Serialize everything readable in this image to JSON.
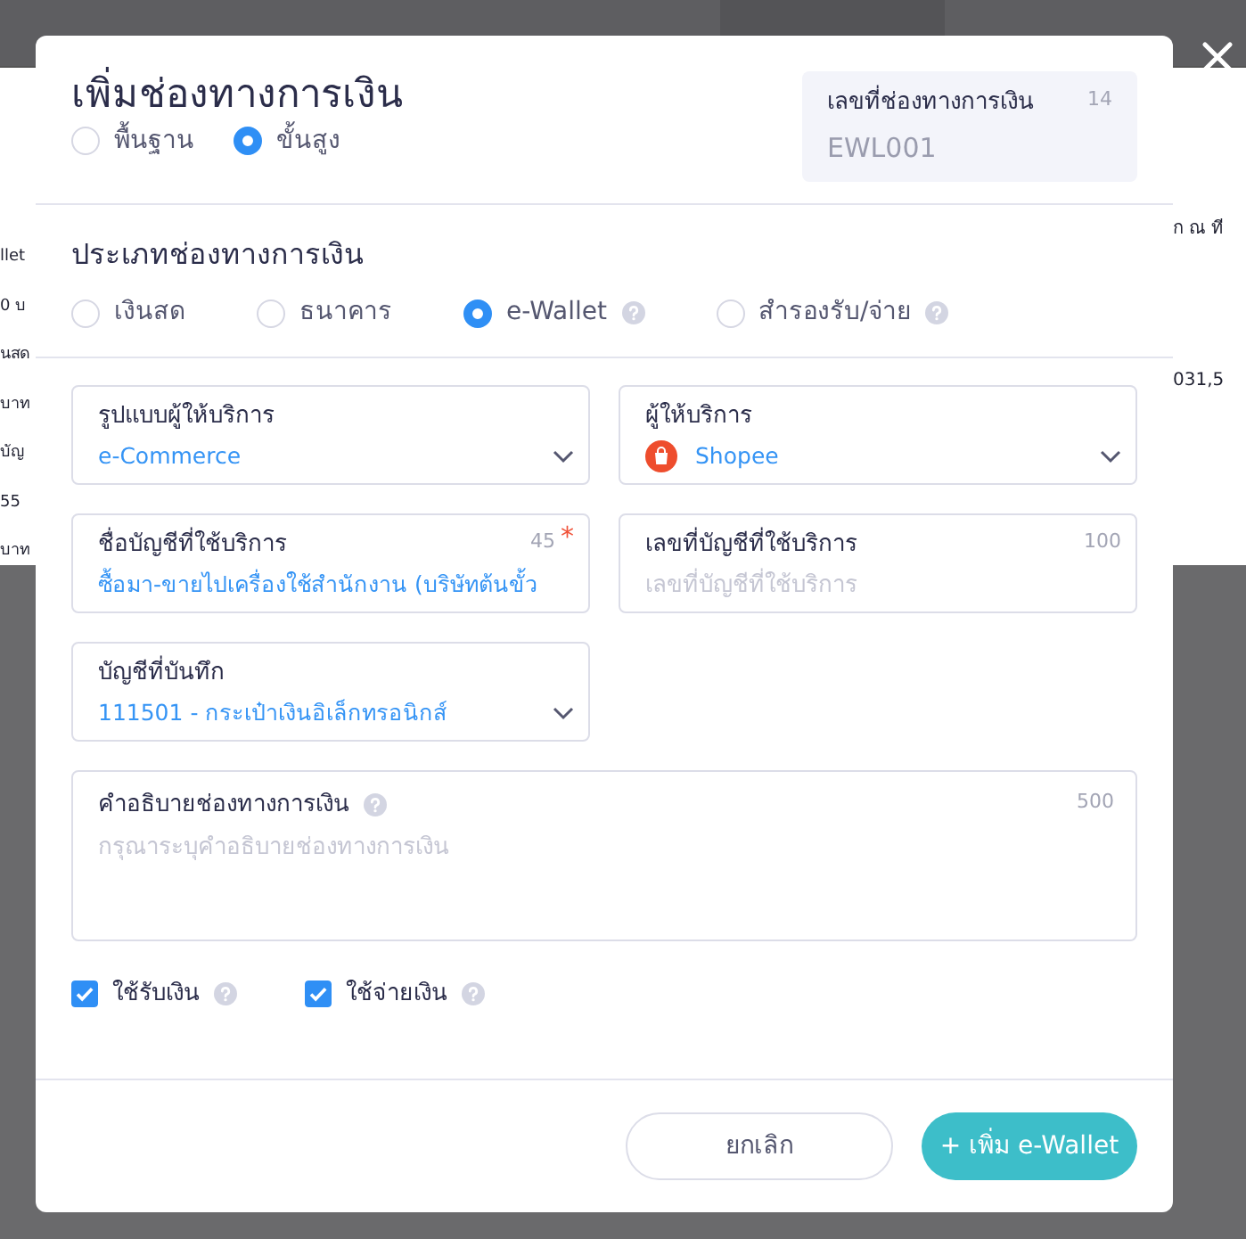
{
  "background": {
    "left_fragments": [
      "llet",
      "0 บ",
      "นสด",
      "บาท",
      "บัญ",
      "55",
      "บาท"
    ],
    "right_fragments": [
      "ก ณ ที",
      "031,5"
    ]
  },
  "header": {
    "title": "เพิ่มช่องทางการเงิน",
    "modes": [
      {
        "label": "พื้นฐาน",
        "selected": false
      },
      {
        "label": "ขั้นสูง",
        "selected": true
      }
    ],
    "code_box": {
      "label": "เลขที่ช่องทางการเงิน",
      "counter": "14",
      "value": "EWL001"
    }
  },
  "type_section": {
    "title": "ประเภทช่องทางการเงิน",
    "options": [
      {
        "label": "เงินสด",
        "selected": false,
        "help": false
      },
      {
        "label": "ธนาคาร",
        "selected": false,
        "help": false
      },
      {
        "label": "e-Wallet",
        "selected": true,
        "help": true
      },
      {
        "label": "สำรองรับ/จ่าย",
        "selected": false,
        "help": true
      }
    ]
  },
  "fields": [
    {
      "kind": "select",
      "label": "รูปแบบผู้ให้บริการ",
      "value": "e-Commerce"
    },
    {
      "kind": "logo-select",
      "label": "ผู้ให้บริการ",
      "value": "Shopee"
    },
    {
      "kind": "input",
      "label": "ชื่อบัญชีที่ใช้บริการ",
      "counter": "45",
      "required_mark": "*",
      "value": "ซื้อมา-ขายไปเครื่องใช้สำนักงาน (บริษัทต้นขั้ว"
    },
    {
      "kind": "input",
      "label": "เลขที่บัญชีที่ใช้บริการ",
      "counter": "100",
      "placeholder": "เลขที่บัญชีที่ใช้บริการ"
    },
    {
      "kind": "select",
      "label": "บัญชีที่บันทึก",
      "value": "111501 - กระเป๋าเงินอิเล็กทรอนิกส์"
    }
  ],
  "description": {
    "label": "คำอธิบายช่องทางการเงิน",
    "help": true,
    "counter": "500",
    "placeholder": "กรุณาระบุคำอธิบายช่องทางการเงิน"
  },
  "checkboxes": [
    {
      "label": "ใช้รับเงิน",
      "checked": true,
      "help": true
    },
    {
      "label": "ใช้จ่ายเงิน",
      "checked": true,
      "help": true
    }
  ],
  "buttons": [
    {
      "kind": "secondary",
      "label": "ยกเลิก"
    },
    {
      "kind": "primary",
      "label": "+ เพิ่ม e-Wallet"
    }
  ]
}
